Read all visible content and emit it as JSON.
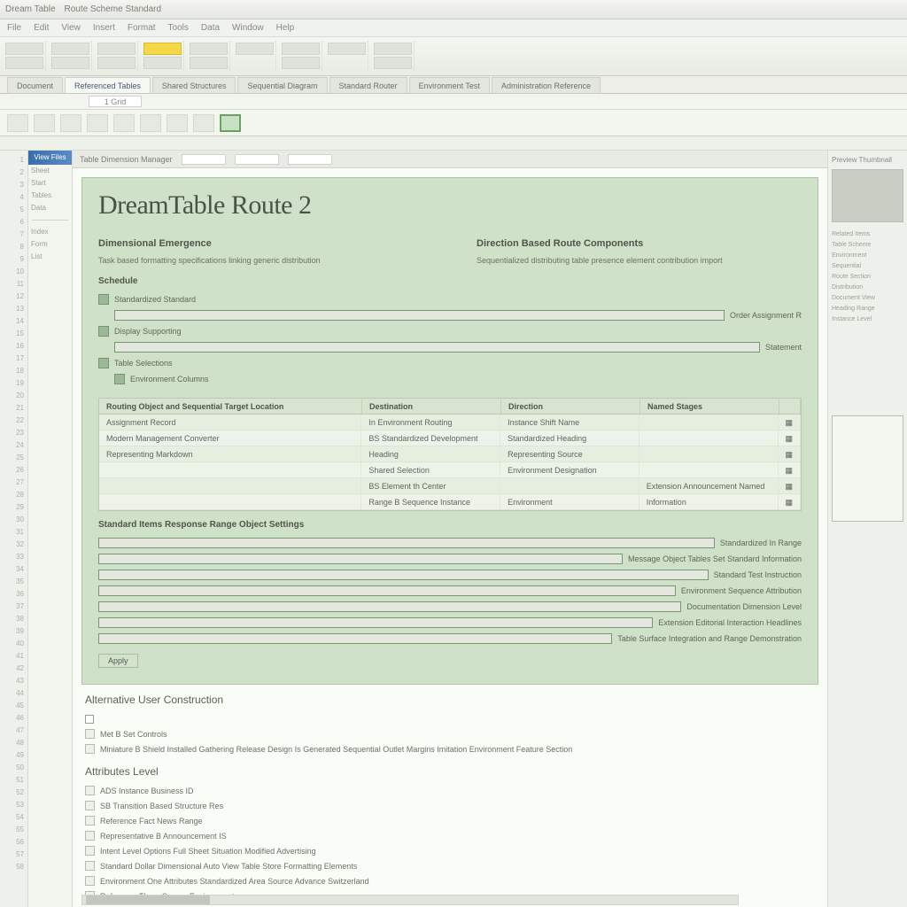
{
  "titlebar": {
    "app": "Dream Table",
    "doc": "Route Scheme Standard"
  },
  "menubar": [
    "File",
    "Edit",
    "View",
    "Insert",
    "Format",
    "Tools",
    "Data",
    "Window",
    "Help"
  ],
  "tabs": [
    "Document",
    "Referenced Tables",
    "Shared Structures",
    "Sequential Diagram",
    "Standard Router",
    "Environment Test",
    "Administration Reference"
  ],
  "subbar": {
    "cell": "1 Grid"
  },
  "document": {
    "toolbar_label": "Table Dimension Manager",
    "title": "DreamTable Route 2",
    "col_left_h": "Dimensional Emergence",
    "col_right_h": "Direction Based Route Components",
    "col_left_line": "Task based formatting specifications linking generic distribution",
    "col_right_line": "Sequentialized distributing table presence element contribution import",
    "section": "Schedule",
    "tree": [
      "Standardized Standard",
      "Order Assignment R",
      "Display Supporting",
      "Statement",
      "Table Selections",
      "Environment Columns"
    ],
    "table": {
      "headers": [
        "Routing Object and Sequential Target Location",
        "Destination",
        "Direction",
        "Named Stages"
      ],
      "rows": [
        [
          "Assignment Record",
          "In Environment Routing",
          "Instance Shift Name",
          ""
        ],
        [
          "Modern Management Converter",
          "BS Standardized Development",
          "Standardized Heading",
          ""
        ],
        [
          "Representing Markdown",
          "Heading",
          "Representing Source",
          ""
        ],
        [
          "",
          "Shared Selection",
          "Environment Designation",
          ""
        ],
        [
          "",
          "BS Element th Center",
          "",
          "Extension Announcement Named Information"
        ],
        [
          "",
          "Range B Sequence Instance",
          "Environment",
          ""
        ]
      ]
    },
    "list_header": "Standard Items Response Range Object Settings",
    "list": [
      "Standardized In Range",
      "Message Object Tables Set Standard Information",
      "Standard Test Instruction",
      "Environment Sequence Attribution",
      "Documentation Dimension Level",
      "Extension Editorial Interaction Headlines",
      "Table Surface Integration and Range Demonstration"
    ],
    "btn": "Apply"
  },
  "section2": {
    "h1": "Alternative User Construction",
    "items1": [
      "Met B Set Controls",
      "Miniature B Shield Installed Gathering Release Design Is Generated Sequential Outlet Margins Imitation Environment Feature Section"
    ],
    "h2": "Attributes Level",
    "items2": [
      "ADS Instance Business ID",
      "SB Transition Based Structure Res",
      "Reference Fact News Range",
      "Representative B Announcement IS",
      "Intent Level Options Full Sheet Situation Modified Advertising",
      "Standard Dollar Dimensional Auto View Table Store Formatting Elements",
      "Environment One Attributes Standardized Area Source Advance Switzerland",
      "Reference Three Source Environment"
    ]
  },
  "nav": {
    "header": "View Files",
    "items": [
      "Sheet",
      "Start",
      "Tables",
      "Data",
      "Index",
      "Form",
      "List"
    ]
  },
  "rpanel": {
    "header": "Preview Thumbnail",
    "items": [
      "Related Items",
      "Table Scheme",
      "Environment",
      "Sequential",
      "Route Section",
      "Distribution",
      "Document View",
      "Heading Range",
      "Instance Level"
    ]
  }
}
